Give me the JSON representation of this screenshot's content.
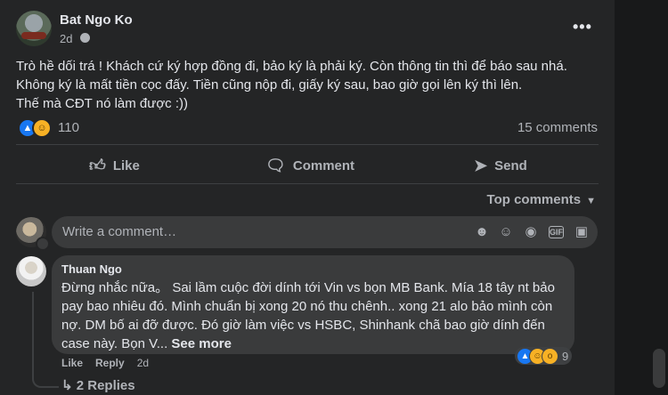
{
  "post": {
    "author": "Bat Ngo Ko",
    "time": "2d",
    "body": "Trò hề dối trá ! Khách cứ ký hợp đồng đi, bảo ký là phải ký. Còn thông tin thì để báo sau nhá.\nKhông ký là mất tiền cọc đấy. Tiền cũng nộp đi, giấy ký sau, bao giờ gọi lên ký thì lên.\nThế mà CĐT nó làm được :))",
    "reaction_count": "110",
    "comments_count": "15 comments"
  },
  "actions": {
    "like": "Like",
    "comment": "Comment",
    "send": "Send"
  },
  "sort": {
    "label": "Top comments"
  },
  "composer": {
    "placeholder": "Write a comment…",
    "icons": [
      "emoji-icon",
      "sticker-icon",
      "camera-icon",
      "gif-icon",
      "sticker-alt-icon"
    ]
  },
  "comment": {
    "author": "Thuan Ngo",
    "body": "Đừng nhắc nữa。 Sai lầm cuộc đời dính tới Vin vs bọn MB Bank. Mía 18 tây nt bảo pay bao nhiêu đó. Mình chuẩn bị xong 20 nó thu chênh.. xong 21 alo bảo mình còn nợ. DM bố ai đỡ được. Đó giờ làm việc vs HSBC, Shinhank chã bao giờ dính đến case này. Bọn V...",
    "see_more": "See more",
    "like": "Like",
    "reply": "Reply",
    "time": "2d",
    "reaction_count": "9",
    "replies": "2 Replies"
  },
  "colors": {
    "card_bg": "#242526",
    "page_bg": "#18191a",
    "like_blue": "#1877f2",
    "haha_yellow": "#f7b125",
    "text_primary": "#e4e6eb",
    "text_secondary": "#b0b3b8"
  }
}
